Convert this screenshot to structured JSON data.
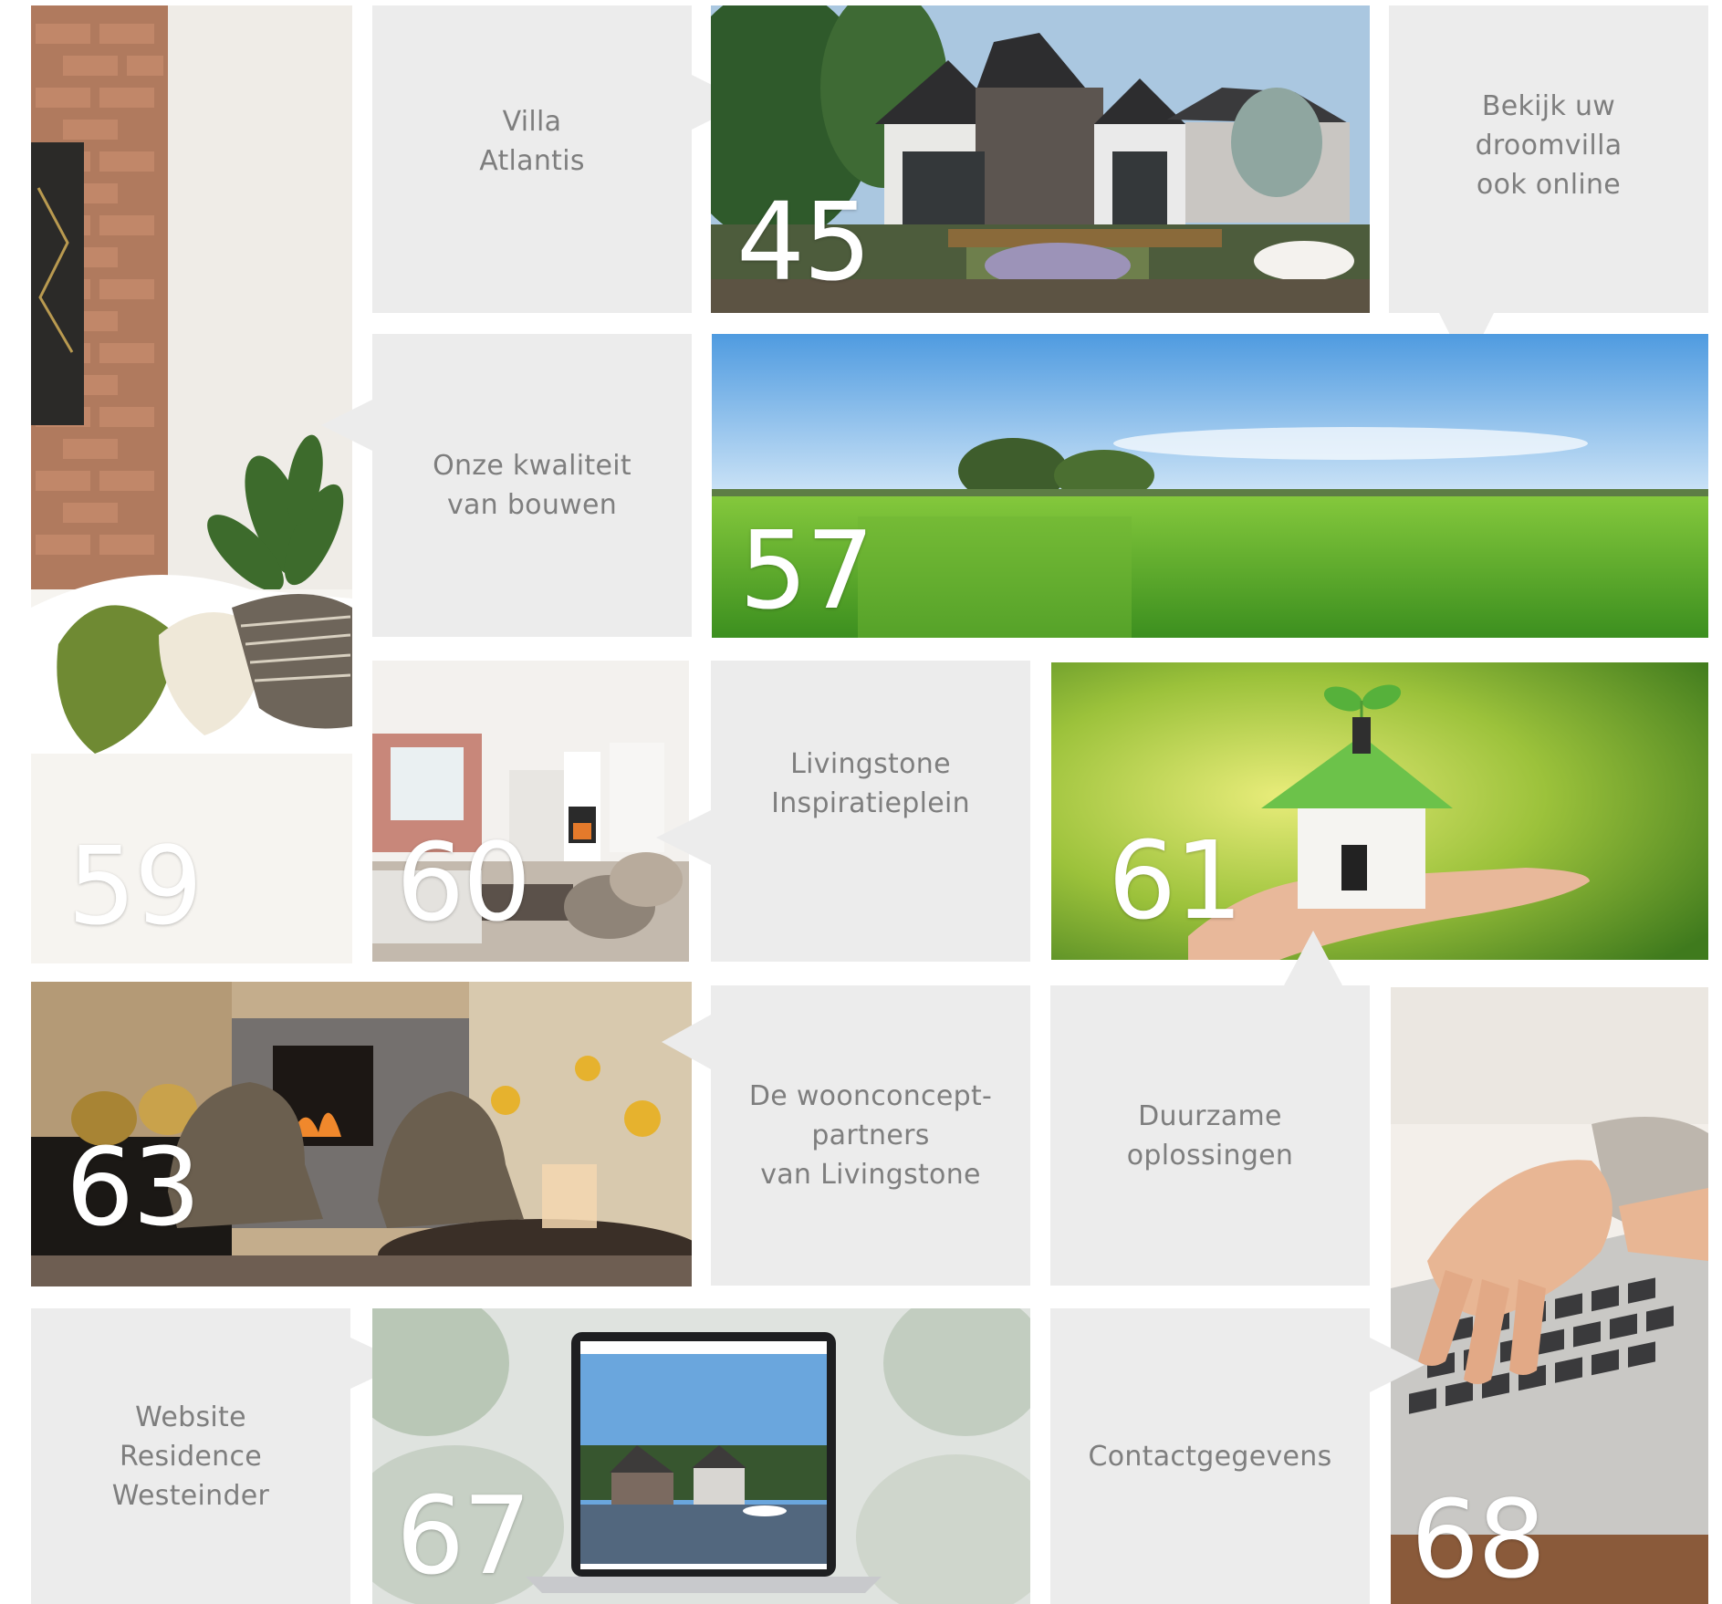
{
  "tiles": {
    "villa_atlantis": {
      "lines": [
        "Villa",
        "Atlantis"
      ],
      "page": "45"
    },
    "droomvilla": {
      "lines": [
        "Bekijk uw",
        "droomvilla",
        "ook online"
      ],
      "page": "57"
    },
    "kwaliteit": {
      "lines": [
        "Onze kwaliteit",
        "van bouwen"
      ],
      "page": "59"
    },
    "inspiratieplein": {
      "lines": [
        "Livingstone",
        "Inspiratieplein"
      ],
      "page": "60"
    },
    "duurzaam_photo": {
      "page": "61"
    },
    "woonconcept": {
      "lines": [
        "De woonconcept-",
        "partners",
        "van Livingstone"
      ],
      "page": "63"
    },
    "duurzame": {
      "lines": [
        "Duurzame",
        "oplossingen"
      ]
    },
    "website": {
      "lines": [
        "Website",
        "Residence",
        "Westeinder"
      ],
      "page": "67"
    },
    "contact": {
      "lines": [
        "Contactgegevens"
      ],
      "page": "68"
    }
  },
  "colors": {
    "tile_bg": "#ececec",
    "tile_text": "#7e7e7e",
    "number": "#ffffff"
  }
}
